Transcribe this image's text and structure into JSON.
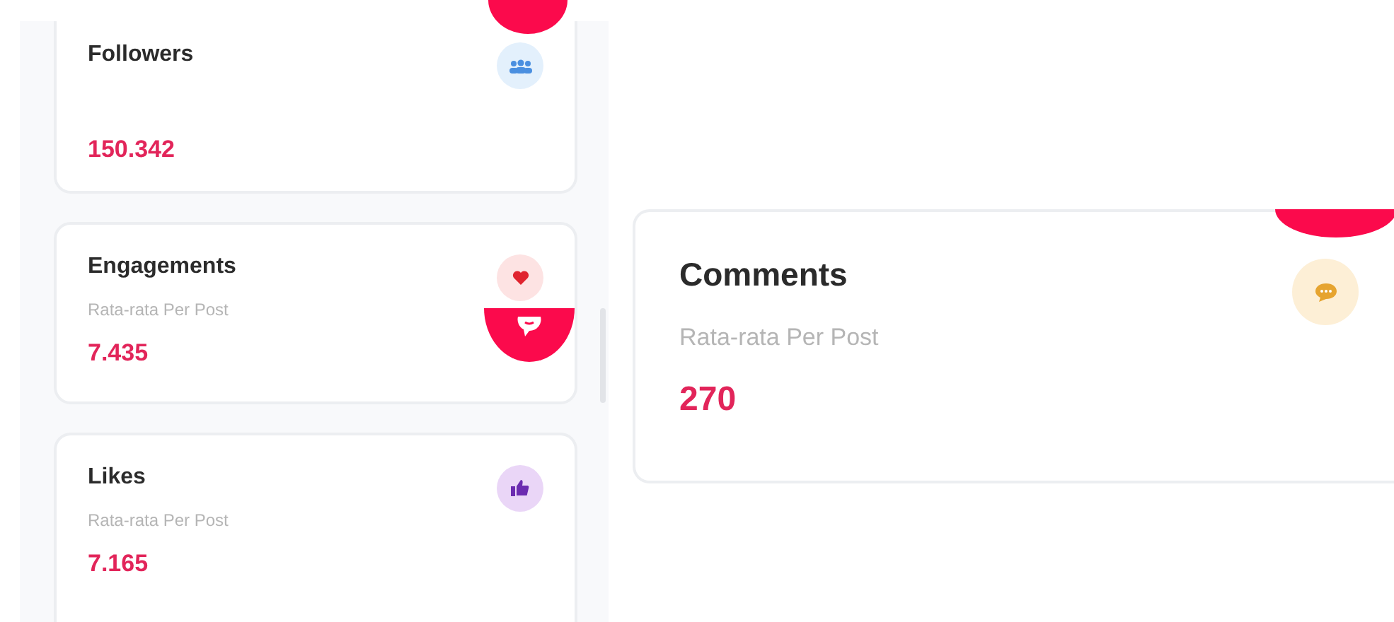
{
  "stat_cards": [
    {
      "kind": "people",
      "title": "Followers",
      "value": "150.342"
    },
    {
      "kind": "heart",
      "title": "Engagements",
      "subtitle": "Rata-rata Per Post",
      "value": "7.435"
    },
    {
      "kind": "thumb",
      "title": "Likes",
      "subtitle": "Rata-rata Per Post",
      "value": "7.165"
    }
  ],
  "detail_card": {
    "kind": "chat",
    "title": "Comments",
    "subtitle": "Rata-rata Per Post",
    "value": "270"
  }
}
